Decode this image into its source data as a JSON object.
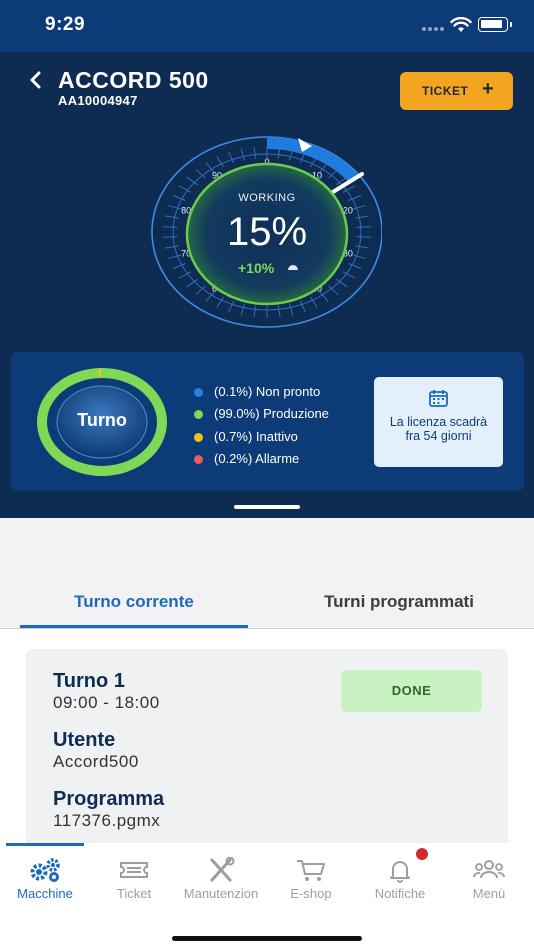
{
  "status_bar": {
    "time": "9:29"
  },
  "header": {
    "title": "ACCORD 500",
    "serial": "AA10004947",
    "ticket_button": "TICKET",
    "ticket_icon": "plus-icon"
  },
  "gauge": {
    "status": "WORKING",
    "percent": "15%",
    "percent_value": 15,
    "delta": "+10%",
    "scale_labels": [
      "0",
      "10",
      "20",
      "30",
      "40",
      "50",
      "60",
      "70",
      "80",
      "90"
    ],
    "accent": "#1f7be0",
    "inner_color": "#6ccb4a"
  },
  "shift_summary": {
    "ring_label": "Turno",
    "legend": [
      {
        "label": "(0.1%) Non pronto",
        "color": "#2a7de1"
      },
      {
        "label": "(99.0%) Produzione",
        "color": "#7ed957"
      },
      {
        "label": "(0.7%) Inattivo",
        "color": "#f1c21b"
      },
      {
        "label": "(0.2%) Allarme",
        "color": "#ef5b5b"
      }
    ]
  },
  "license": {
    "text": "La licenza scadrà fra 54 giorni",
    "icon": "calendar-icon"
  },
  "tabs": [
    {
      "label": "Turno corrente",
      "active": true
    },
    {
      "label": "Turni programmati",
      "active": false
    }
  ],
  "shift": {
    "name": "Turno 1",
    "hours": "09:00 - 18:00",
    "status": "DONE",
    "user_label": "Utente",
    "user_value": "Accord500",
    "program_label": "Programma",
    "program_value": "117376.pgmx"
  },
  "nav": [
    {
      "label": "Macchine",
      "icon": "gears-icon",
      "active": true
    },
    {
      "label": "Ticket",
      "icon": "ticket-icon",
      "active": false
    },
    {
      "label": "Manutenzion",
      "icon": "tools-icon",
      "active": false
    },
    {
      "label": "E-shop",
      "icon": "cart-icon",
      "active": false
    },
    {
      "label": "Notifiche",
      "icon": "bell-icon",
      "active": false
    },
    {
      "label": "Menù",
      "icon": "users-icon",
      "active": false
    }
  ]
}
